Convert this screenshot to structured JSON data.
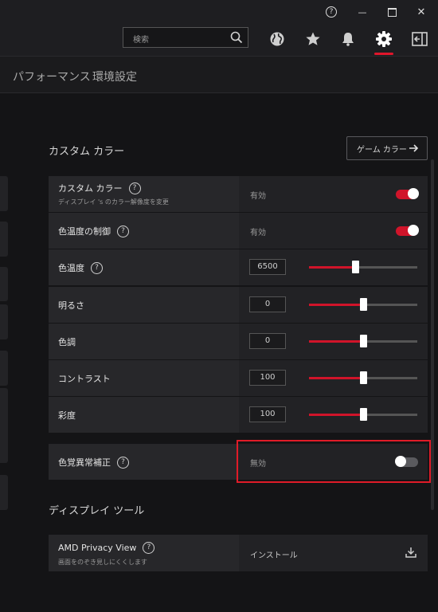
{
  "titlebar": {
    "help_glyph": "?",
    "minimize_glyph": "—",
    "maximize_glyph": "☐",
    "close_glyph": "✕"
  },
  "header": {
    "search_placeholder": "検索",
    "accent_color": "#e0162b"
  },
  "subnav": {
    "items": [
      "パフォーマンス",
      "環境設定"
    ]
  },
  "custom_color": {
    "title": "カスタム カラー",
    "game_color_button": "ゲーム カラー",
    "rows": [
      {
        "label": "カスタム カラー",
        "sub": "ディスプレイ 's のカラー解像度を変更",
        "status": "有効",
        "toggle_on": true
      },
      {
        "label": "色温度の制御",
        "status": "有効",
        "toggle_on": true
      },
      {
        "label": "色温度",
        "value": "6500",
        "level": 0.43
      },
      {
        "label": "明るさ",
        "value": "0",
        "level": 0.5
      },
      {
        "label": "色調",
        "value": "0",
        "level": 0.5
      },
      {
        "label": "コントラスト",
        "value": "100",
        "level": 0.5
      },
      {
        "label": "彩度",
        "value": "100",
        "level": 0.5
      }
    ],
    "color_blind": {
      "label": "色覚異常補正",
      "status": "無効",
      "toggle_on": false
    }
  },
  "display_tools": {
    "title": "ディスプレイ ツール",
    "privacy": {
      "label": "AMD Privacy View",
      "sub": "画面をのぞき見しにくくします",
      "action": "インストール"
    }
  }
}
